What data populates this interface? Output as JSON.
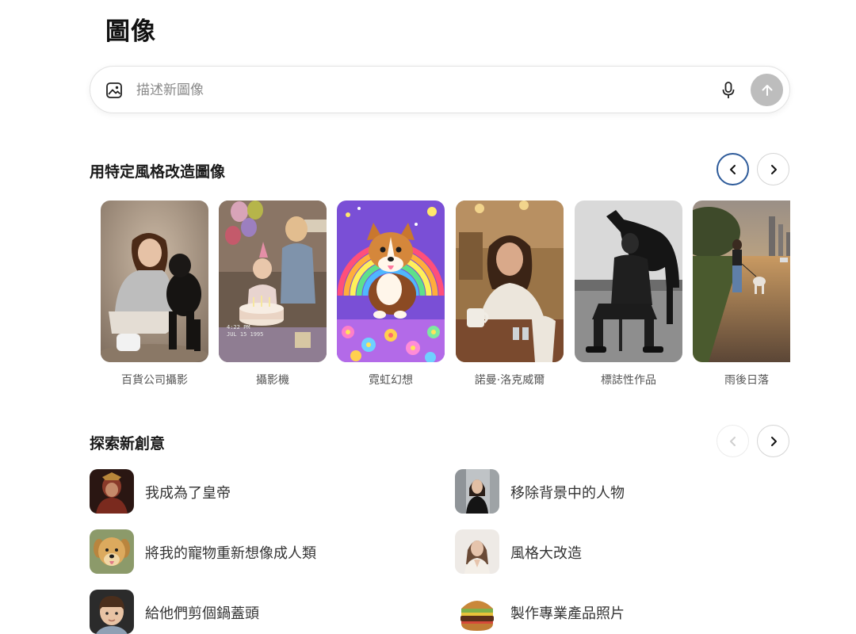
{
  "page": {
    "title": "圖像"
  },
  "prompt": {
    "placeholder": "描述新圖像",
    "value": ""
  },
  "icons": {
    "image": "image-icon",
    "mic": "microphone-icon",
    "send": "arrow-up-icon",
    "prev": "chevron-left-icon",
    "next": "chevron-right-icon"
  },
  "styles_section": {
    "title": "用特定風格改造圖像",
    "cards": [
      {
        "label": "百貨公司攝影"
      },
      {
        "label": "攝影機",
        "stamp_time": "4:22 PM",
        "stamp_date": "JUL 15 1995"
      },
      {
        "label": "霓虹幻想"
      },
      {
        "label": "諾曼·洛克威爾"
      },
      {
        "label": "標誌性作品"
      },
      {
        "label": "雨後日落"
      }
    ]
  },
  "ideas_section": {
    "title": "探索新創意",
    "items": [
      {
        "label": "我成為了皇帝"
      },
      {
        "label": "移除背景中的人物"
      },
      {
        "label": "將我的寵物重新想像成人類"
      },
      {
        "label": "風格大改造"
      },
      {
        "label": "給他們剪個鍋蓋頭"
      },
      {
        "label": "製作專業產品照片"
      }
    ]
  },
  "colors": {
    "send_button": "#bdbdbd",
    "active_nav_border": "#2e5b9a",
    "text_secondary": "#555555"
  }
}
